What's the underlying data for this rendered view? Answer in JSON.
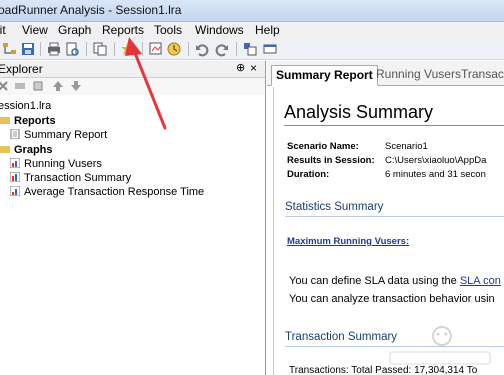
{
  "window": {
    "title": "oadRunner Analysis - Session1.lra"
  },
  "menu": [
    "lit",
    "View",
    "Graph",
    "Reports",
    "Tools",
    "Windows",
    "Help"
  ],
  "explorer": {
    "title": "Explorer",
    "pin": "⊕",
    "close": "×",
    "tree": {
      "root": "ession1.lra",
      "reports_label": "Reports",
      "summary_report": "Summary Report",
      "graphs_label": "Graphs",
      "graphs": [
        "Running Vusers",
        "Transaction Summary",
        "Average Transaction Response Time"
      ]
    }
  },
  "tabs": [
    "Summary Report",
    "Running Vusers",
    "Transac"
  ],
  "report": {
    "heading": "Analysis Summary",
    "scenario_label": "Scenario Name:",
    "scenario_value": "Scenario1",
    "results_label": "Results in Session:",
    "results_value": "C:\\Users\\xiaoluo\\AppDa",
    "duration_label": "Duration:",
    "duration_value": "6 minutes and 31 secon",
    "stats_title": "Statistics Summary",
    "max_vusers_link": "Maximum Running Vusers:",
    "sla_prefix": "You can define SLA data using the ",
    "sla_link": "SLA con",
    "analyze_text": "You can analyze transaction behavior usin",
    "txn_title": "Transaction Summary",
    "txn_line": "Transactions: Total Passed: 17,304,314 To"
  },
  "colors": {
    "annotation_arrow": "#e8333b",
    "link": "#1e3d8a",
    "section": "#1d3e6e"
  }
}
